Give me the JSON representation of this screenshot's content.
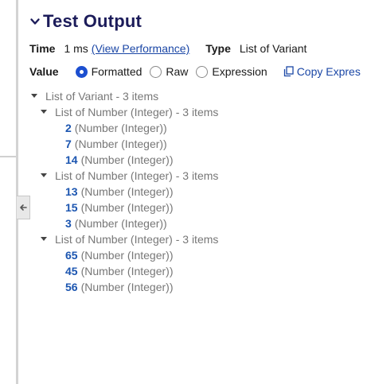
{
  "title": "Test Output",
  "time": {
    "label": "Time",
    "value": "1 ms",
    "link": "(View Performance)"
  },
  "type_info": {
    "label": "Type",
    "value": "List of Variant"
  },
  "value_mode": {
    "label": "Value",
    "options": [
      {
        "label": "Formatted",
        "checked": true
      },
      {
        "label": "Raw",
        "checked": false
      },
      {
        "label": "Expression",
        "checked": false
      }
    ],
    "copy_label": "Copy Expres"
  },
  "tree": {
    "root_label": "List of Variant - 3 items",
    "groups": [
      {
        "label": "List of Number (Integer) - 3 items",
        "items": [
          {
            "value": "2",
            "type": "(Number (Integer))"
          },
          {
            "value": "7",
            "type": "(Number (Integer))"
          },
          {
            "value": "14",
            "type": "(Number (Integer))"
          }
        ]
      },
      {
        "label": "List of Number (Integer) - 3 items",
        "items": [
          {
            "value": "13",
            "type": "(Number (Integer))"
          },
          {
            "value": "15",
            "type": "(Number (Integer))"
          },
          {
            "value": "3",
            "type": "(Number (Integer))"
          }
        ]
      },
      {
        "label": "List of Number (Integer) - 3 items",
        "items": [
          {
            "value": "65",
            "type": "(Number (Integer))"
          },
          {
            "value": "45",
            "type": "(Number (Integer))"
          },
          {
            "value": "56",
            "type": "(Number (Integer))"
          }
        ]
      }
    ]
  },
  "colors": {
    "title": "#1c1c5a",
    "link": "#1b47a6",
    "accent": "#1c4fd0",
    "number": "#1b55b0",
    "muted": "#777777"
  },
  "icons": {
    "header_toggle": "chevron-down-icon",
    "collapse": "arrow-left-icon",
    "copy": "copy-icon",
    "tree_toggle": "caret-down-icon"
  }
}
